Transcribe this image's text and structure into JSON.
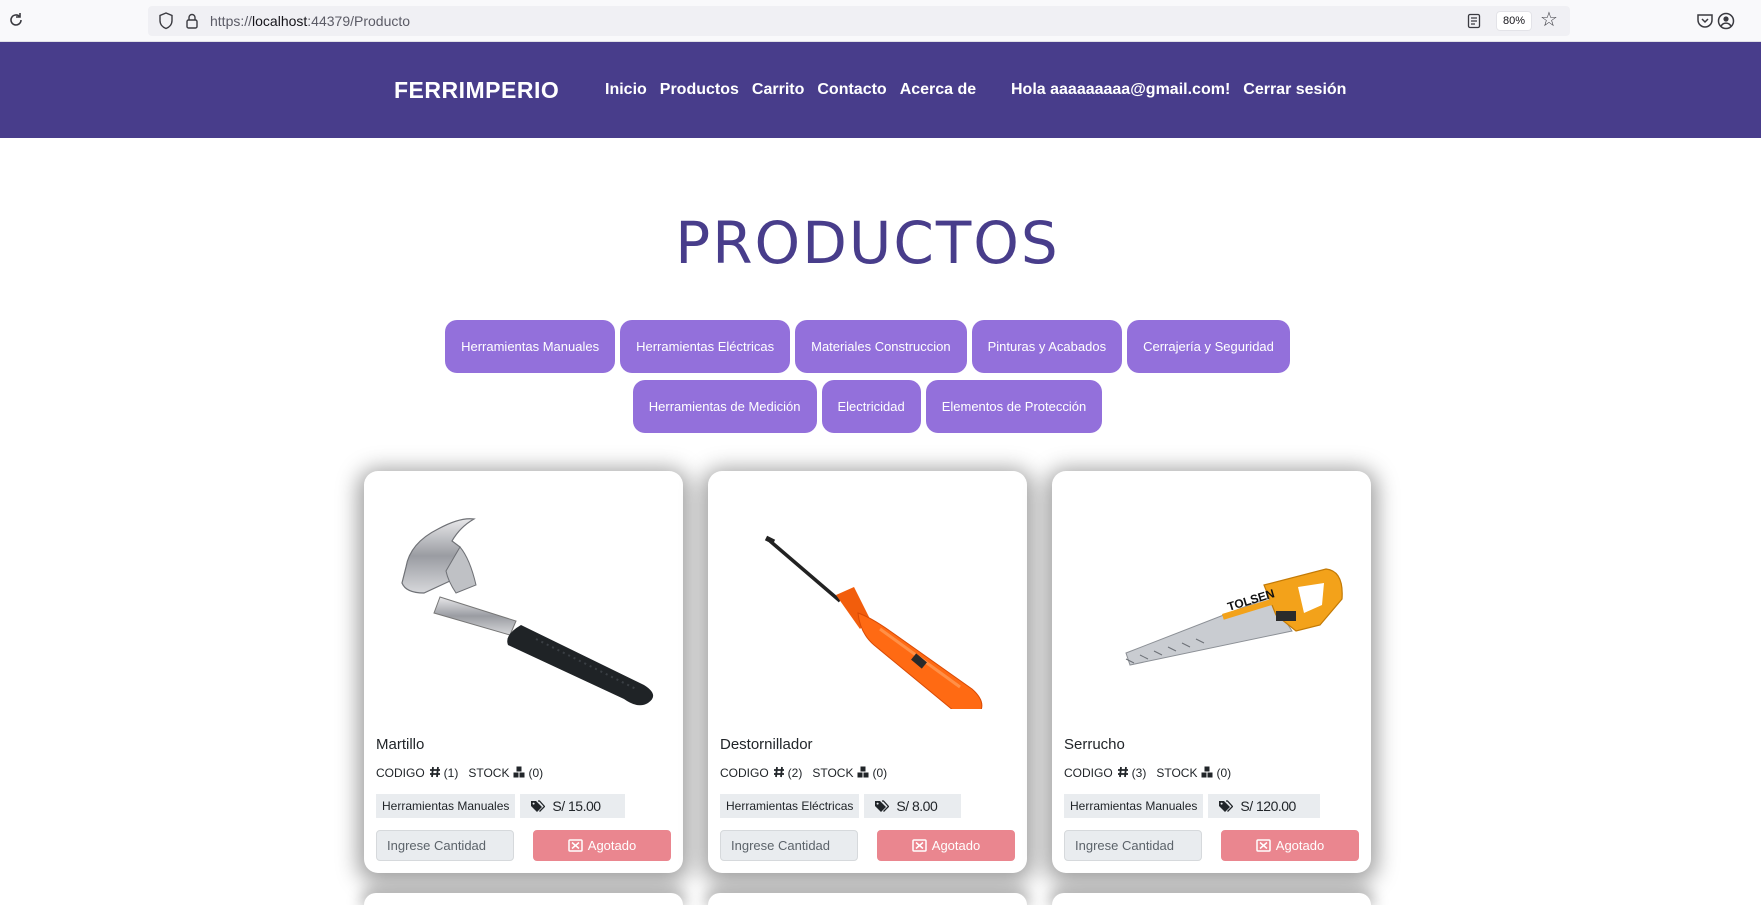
{
  "browser": {
    "url_prefix": "https://",
    "url_host": "localhost",
    "url_rest": ":44379/Producto",
    "zoom": "80%"
  },
  "nav": {
    "brand": "FERRIMPERIO",
    "links": [
      "Inicio",
      "Productos",
      "Carrito",
      "Contacto",
      "Acerca de"
    ],
    "greeting": "Hola aaaaaaaaa@gmail.com!",
    "logout": "Cerrar sesión"
  },
  "page": {
    "title": "PRODUCTOS"
  },
  "categories": [
    "Herramientas Manuales",
    "Herramientas Eléctricas",
    "Materiales Construccion",
    "Pinturas y Acabados",
    "Cerrajería y Seguridad",
    "Herramientas de Medición",
    "Electricidad",
    "Elementos de Protección"
  ],
  "labels": {
    "code": "CODIGO",
    "stock": "STOCK",
    "qty_placeholder": "Ingrese Cantidad",
    "out_of_stock": "Agotado"
  },
  "products": [
    {
      "name": "Martillo",
      "code": "(1)",
      "stock": "(0)",
      "category": "Herramientas Manuales",
      "price": "S/ 15.00",
      "image": "hammer"
    },
    {
      "name": "Destornillador",
      "code": "(2)",
      "stock": "(0)",
      "category": "Herramientas Eléctricas",
      "price": "S/ 8.00",
      "image": "screwdriver"
    },
    {
      "name": "Serrucho",
      "code": "(3)",
      "stock": "(0)",
      "category": "Herramientas Manuales",
      "price": "S/ 120.00",
      "image": "saw"
    }
  ],
  "colors": {
    "navbar": "#483d8b",
    "category_button": "#9370db",
    "sold_out_button": "#ea868f"
  },
  "icons": [
    "reload-icon",
    "shield-icon",
    "lock-icon",
    "reader-view-icon",
    "bookmark-star-icon",
    "pocket-icon",
    "account-icon",
    "hash-icon",
    "boxes-icon",
    "tags-icon",
    "cart-x-icon"
  ]
}
